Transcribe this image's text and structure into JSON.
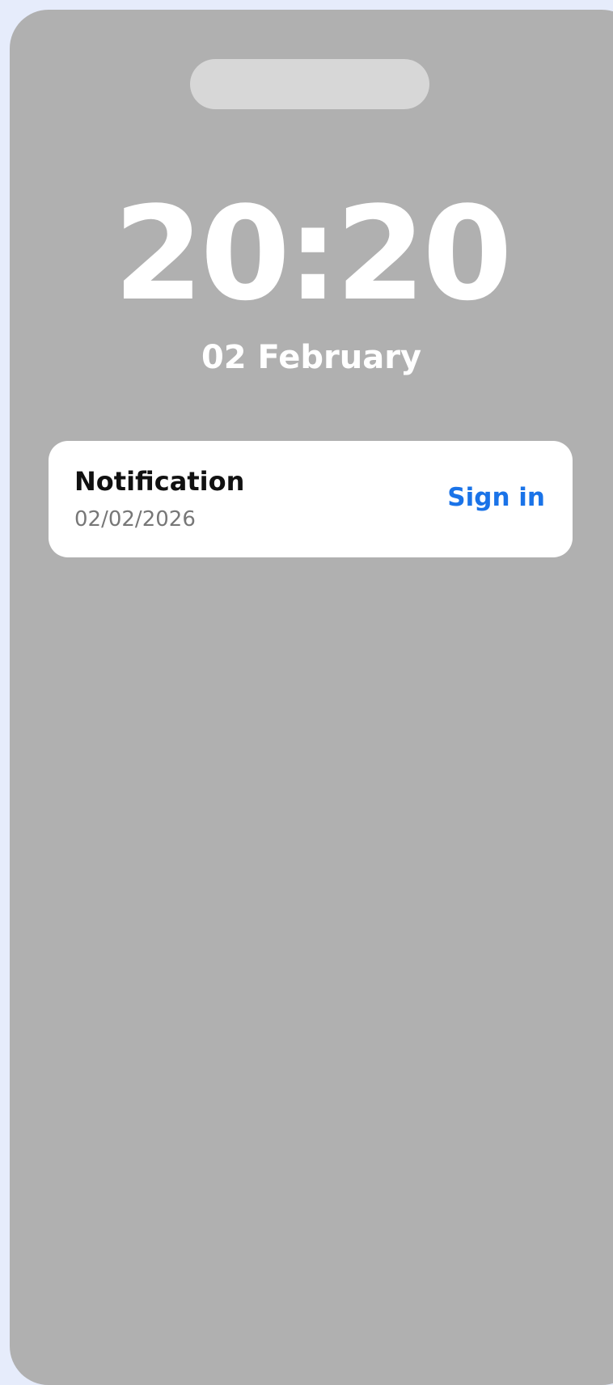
{
  "lockscreen": {
    "time": "20:20",
    "date": "02 February"
  },
  "notification": {
    "title": "Notification",
    "timestamp": "02/02/2026",
    "action_label": "Sign in"
  },
  "colors": {
    "background": "#e6ecfb",
    "screen": "#b0b0b0",
    "accent": "#1a73e8",
    "card": "#ffffff"
  }
}
